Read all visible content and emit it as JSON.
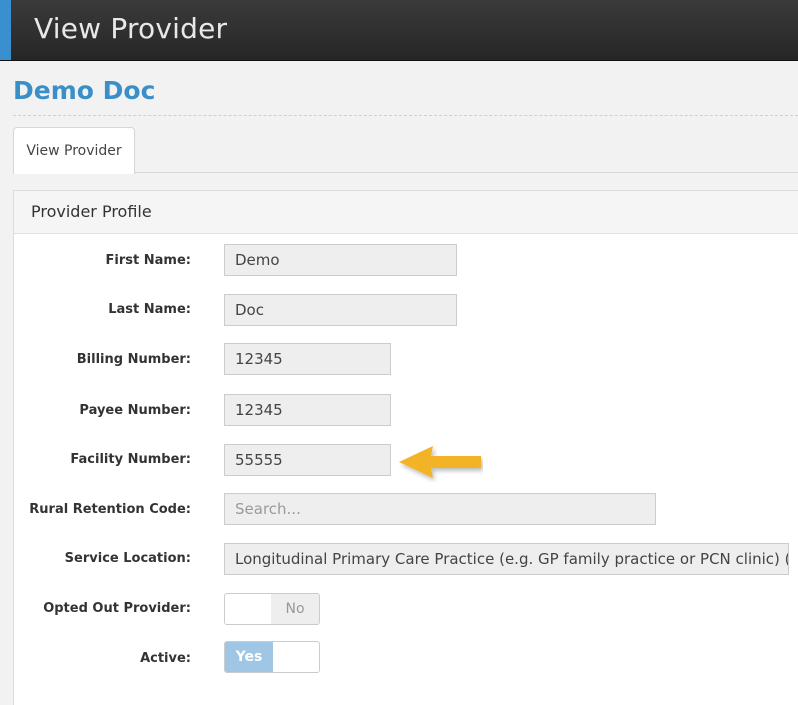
{
  "header": {
    "title": "View Provider"
  },
  "page": {
    "name": "Demo Doc"
  },
  "tabs": [
    {
      "label": "View Provider"
    }
  ],
  "panel": {
    "title": "Provider Profile"
  },
  "fields": {
    "first_name": {
      "label": "First Name:",
      "value": "Demo"
    },
    "last_name": {
      "label": "Last Name:",
      "value": "Doc"
    },
    "billing_number": {
      "label": "Billing Number:",
      "value": "12345"
    },
    "payee_number": {
      "label": "Payee Number:",
      "value": "12345"
    },
    "facility_number": {
      "label": "Facility Number:",
      "value": "55555"
    },
    "rural_retention_code": {
      "label": "Rural Retention Code:",
      "placeholder": "Search..."
    },
    "service_location": {
      "label": "Service Location:",
      "value": "Longitudinal Primary Care Practice (e.g. GP family practice or PCN clinic) (L)"
    },
    "opted_out_provider": {
      "label": "Opted Out Provider:",
      "state": "No"
    },
    "active": {
      "label": "Active:",
      "state": "Yes"
    }
  },
  "colors": {
    "accent": "#3a8fd0",
    "page_title": "#3b8fc9",
    "toggle_yes": "#9fc6e4",
    "arrow": "#f3b325"
  }
}
